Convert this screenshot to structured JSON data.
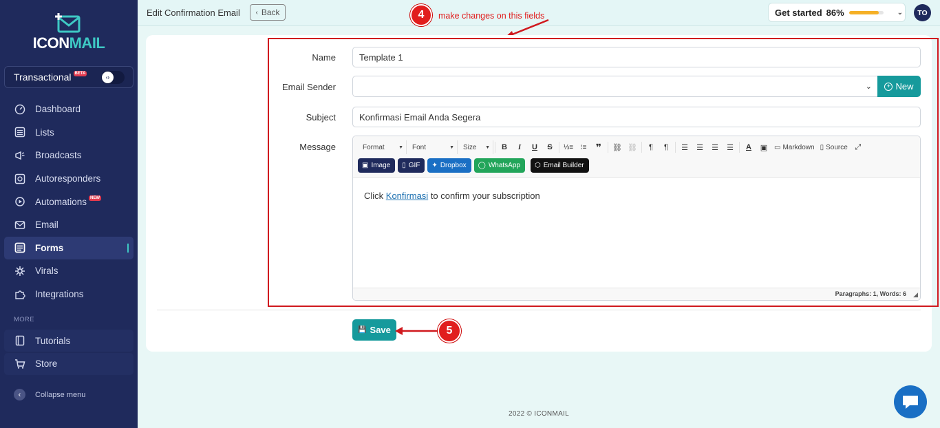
{
  "brand": {
    "name_part1": "ICON",
    "name_part2": "MAIL",
    "accent": "#3ec8c4",
    "sidebar_bg": "#1f2a5c",
    "primary": "#169a9c"
  },
  "sidebar": {
    "transactional": {
      "label": "Transactional",
      "badge": "BETA"
    },
    "items": [
      {
        "label": "Dashboard",
        "icon": "dashboard-icon"
      },
      {
        "label": "Lists",
        "icon": "list-icon"
      },
      {
        "label": "Broadcasts",
        "icon": "megaphone-icon"
      },
      {
        "label": "Autoresponders",
        "icon": "autoresponder-icon"
      },
      {
        "label": "Automations",
        "icon": "automation-icon",
        "badge": "NEW"
      },
      {
        "label": "Email",
        "icon": "envelope-icon"
      },
      {
        "label": "Forms",
        "icon": "form-icon",
        "active": true
      },
      {
        "label": "Virals",
        "icon": "viral-icon"
      },
      {
        "label": "Integrations",
        "icon": "puzzle-icon"
      }
    ],
    "more_label": "MORE",
    "more_items": [
      {
        "label": "Tutorials",
        "icon": "book-icon"
      },
      {
        "label": "Store",
        "icon": "cart-icon"
      }
    ],
    "collapse_label": "Collapse menu"
  },
  "topbar": {
    "title": "Edit Confirmation Email",
    "back_label": "Back",
    "get_started_label": "Get started",
    "progress_pct": "86%",
    "progress_value": 0.86,
    "avatar_initials": "TO"
  },
  "annotations": {
    "step4": "4",
    "step4_text": "make changes on this fields",
    "step5": "5"
  },
  "form": {
    "name_label": "Name",
    "name_value": "Template 1",
    "sender_label": "Email Sender",
    "sender_value": "",
    "new_label": "New",
    "subject_label": "Subject",
    "subject_value": "Konfirmasi Email Anda Segera",
    "message_label": "Message",
    "save_label": "Save"
  },
  "editor": {
    "format_label": "Format",
    "font_label": "Font",
    "size_label": "Size",
    "markdown_label": "Markdown",
    "source_label": "Source",
    "insert_buttons": [
      {
        "label": "Image",
        "color": "#1f2a5c"
      },
      {
        "label": "GIF",
        "color": "#1f2a5c"
      },
      {
        "label": "Dropbox",
        "color": "#1a6fc4"
      },
      {
        "label": "WhatsApp",
        "color": "#22a55a"
      },
      {
        "label": "Email Builder",
        "color": "#111111"
      }
    ],
    "body_prefix": "Click ",
    "body_link": "Konfirmasi",
    "body_suffix": " to confirm your subscription",
    "status": "Paragraphs: 1, Words: 6"
  },
  "footer": {
    "text": "2022 © ICONMAIL"
  }
}
